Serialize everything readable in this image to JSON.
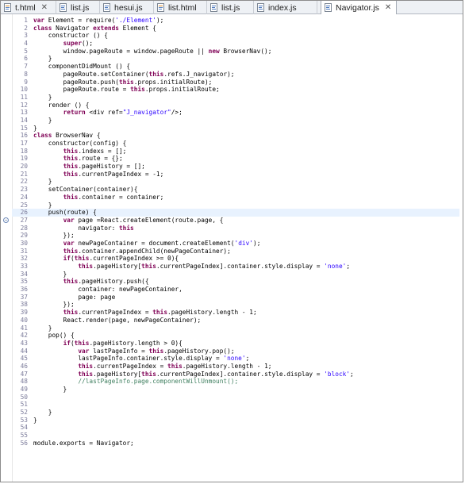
{
  "tabs": [
    {
      "label": "t.html",
      "icon": "html-file-icon",
      "active": false,
      "closable": true
    },
    {
      "label": "list.js",
      "icon": "js-file-icon",
      "active": false,
      "closable": false
    },
    {
      "label": "hesui.js",
      "icon": "js-file-icon",
      "active": false,
      "closable": false
    },
    {
      "label": "list.html",
      "icon": "html-file-icon",
      "active": false,
      "closable": false
    },
    {
      "label": "list.js",
      "icon": "js-file-icon",
      "active": false,
      "closable": false
    },
    {
      "label": "index.js",
      "icon": "js-file-icon",
      "active": false,
      "closable": false
    },
    {
      "label": "Navigator.js",
      "icon": "js-file-icon",
      "active": true,
      "closable": true
    }
  ],
  "colors": {
    "keyword": "#7f0055",
    "string": "#2a00ff",
    "comment": "#3f7f5f",
    "line_number": "#7b7b9a",
    "current_line": "#e8f2fe"
  },
  "editor": {
    "current_line": 26,
    "fold_markers": [
      27
    ],
    "lines": [
      "var Element = require('./Element');",
      "class Navigator extends Element {",
      "    constructor () {",
      "        super();",
      "        window.pageRoute = window.pageRoute || new BrowserNav();",
      "    }",
      "    componentDidMount () {",
      "        pageRoute.setContainer(this.refs.J_navigator);",
      "        pageRoute.push(this.props.initialRoute);",
      "        pageRoute.route = this.props.initialRoute;",
      "    }",
      "    render () {",
      "        return <div ref=\"J_navigator\"/>;",
      "    }",
      "}",
      "class BrowserNav {",
      "    constructor(config) {",
      "        this.indexs = [];",
      "        this.route = {};",
      "        this.pageHistory = [];",
      "        this.currentPageIndex = -1;",
      "    }",
      "    setContainer(container){",
      "        this.container = container;",
      "    }",
      "    push(route) {",
      "        var page =React.createElement(route.page, {",
      "            navigator: this",
      "        });",
      "        var newPageContainer = document.createElement('div');",
      "        this.container.appendChild(newPageContainer);",
      "        if(this.currentPageIndex >= 0){",
      "            this.pageHistory[this.currentPageIndex].container.style.display = 'none';",
      "        }",
      "        this.pageHistory.push({",
      "            container: newPageContainer,",
      "            page: page",
      "        });",
      "        this.currentPageIndex = this.pageHistory.length - 1;",
      "        React.render(page, newPageContainer);",
      "    }",
      "    pop() {",
      "        if(this.pageHistory.length > 0){",
      "            var lastPageInfo = this.pageHistory.pop();",
      "            lastPageInfo.container.style.display = 'none';",
      "            this.currentPageIndex = this.pageHistory.length - 1;",
      "            this.pageHistory[this.currentPageIndex].container.style.display = 'block';",
      "            //lastPageInfo.page.componentWillUnmount();",
      "        }",
      "",
      "",
      "    }",
      "}",
      "",
      "",
      "module.exports = Navigator;"
    ]
  }
}
